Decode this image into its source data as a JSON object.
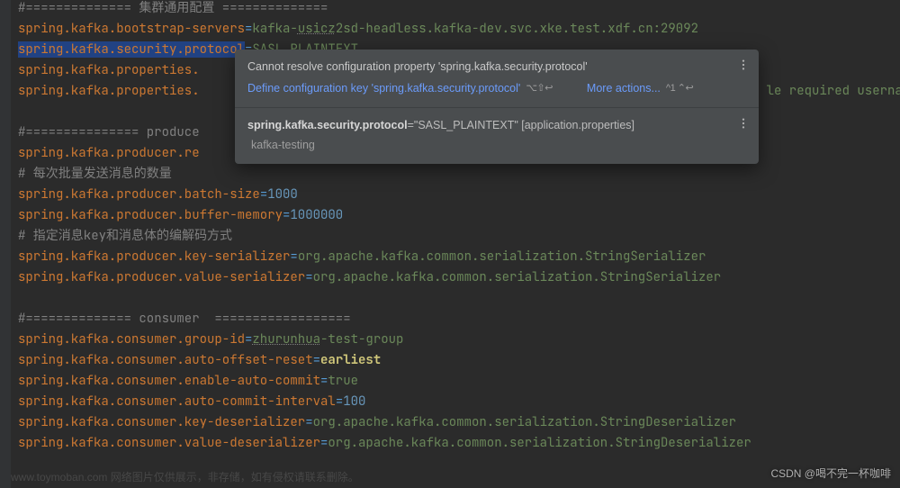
{
  "code": {
    "l0": "#============== 集群通用配置 ==============",
    "l1_k": "spring.kafka.bootstrap-servers",
    "l1_v1": "kafka-",
    "l1_v2": "usicz",
    "l1_v3": "2sd-headless.kafka-dev.svc.xke.test.xdf.cn:29092",
    "l2_k": "spring.kafka.security.protocol",
    "l2_v": "SASL_PLAINTEXT",
    "l3_k": "spring.kafka.properties.",
    "l4_k": "spring.kafka.properties.",
    "l4_tail": "le required userna",
    "l6": "#=============== produce",
    "l7_k": "spring.kafka.producer.re",
    "l8": "# 每次批量发送消息的数量",
    "l9_k": "spring.kafka.producer.batch-size",
    "l9_v": "1000",
    "l10_k": "spring.kafka.producer.buffer-memory",
    "l10_v": "1000000",
    "l11": "# 指定消息key和消息体的编解码方式",
    "l12_k": "spring.kafka.producer.key-serializer",
    "l12_v": "org.apache.kafka.common.serialization.StringSerializer",
    "l13_k": "spring.kafka.producer.value-serializer",
    "l13_v": "org.apache.kafka.common.serialization.StringSerializer",
    "l15": "#============== consumer  ==================",
    "l16_k": "spring.kafka.consumer.group-id",
    "l16_v1": "zhurunhua",
    "l16_v2": "-test-group",
    "l17_k": "spring.kafka.consumer.auto-offset-reset",
    "l17_v": "earliest",
    "l18_k": "spring.kafka.consumer.enable-auto-commit",
    "l18_v": "true",
    "l19_k": "spring.kafka.consumer.auto-commit-interval",
    "l19_v": "100",
    "l20_k": "spring.kafka.consumer.key-deserializer",
    "l20_v": "org.apache.kafka.common.serialization.StringDeserializer",
    "l21_k": "spring.kafka.consumer.value-deserializer",
    "l21_v": "org.apache.kafka.common.serialization.StringDeserializer"
  },
  "popup": {
    "title": "Cannot resolve configuration property 'spring.kafka.security.protocol'",
    "define": "Define configuration key 'spring.kafka.security.protocol'",
    "define_sc": "⌥⇧↩",
    "more": "More actions...",
    "more_sc": "^1 ⌃↩",
    "prop_key": "spring.kafka.security.protocol",
    "prop_rest": "=\"SASL_PLAINTEXT\" [application.properties]",
    "module": "kafka-testing"
  },
  "wm": "CSDN @喝不完一杯咖啡",
  "fade": "www.toymoban.com 网络图片仅供展示，非存储，如有侵权请联系删除。"
}
